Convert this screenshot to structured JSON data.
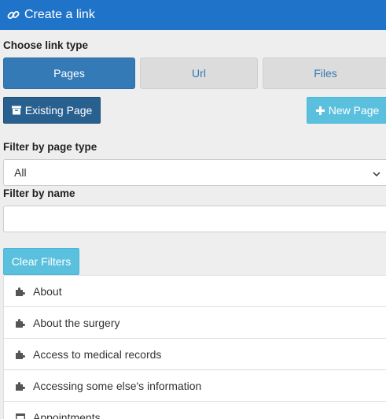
{
  "header": {
    "title": "Create a link",
    "icon": "link-icon"
  },
  "link_type": {
    "label": "Choose link type",
    "options": [
      "Pages",
      "Url",
      "Files"
    ],
    "selected": "Pages"
  },
  "page_buttons": {
    "existing": "Existing Page",
    "new": "New Page"
  },
  "filter_type": {
    "label": "Filter by page type",
    "value": "All"
  },
  "filter_name": {
    "label": "Filter by name",
    "value": ""
  },
  "clear_label": "Clear Filters",
  "pages": [
    "About",
    "About the surgery",
    "Access to medical records",
    "Accessing some else's information",
    "Appointments"
  ],
  "colors": {
    "header": "#1f74c9",
    "primary": "#337ab7",
    "info": "#5bc0de"
  }
}
